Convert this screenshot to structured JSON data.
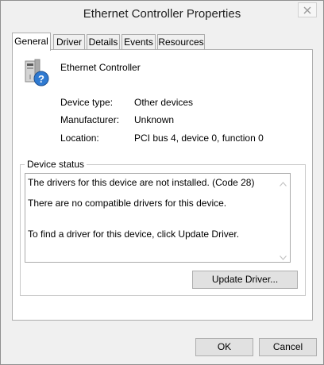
{
  "window": {
    "title": "Ethernet Controller Properties"
  },
  "tabs": [
    {
      "label": "General",
      "active": true
    },
    {
      "label": "Driver",
      "active": false
    },
    {
      "label": "Details",
      "active": false
    },
    {
      "label": "Events",
      "active": false
    },
    {
      "label": "Resources",
      "active": false
    }
  ],
  "device": {
    "name": "Ethernet Controller",
    "icon": "unknown-device-icon"
  },
  "properties": {
    "type_label": "Device type:",
    "type_value": "Other devices",
    "manufacturer_label": "Manufacturer:",
    "manufacturer_value": "Unknown",
    "location_label": "Location:",
    "location_value": "PCI bus 4, device 0, function 0"
  },
  "device_status": {
    "label": "Device status",
    "lines": [
      "The drivers for this device are not installed. (Code 28)",
      "There are no compatible drivers for this device.",
      "To find a driver for this device, click Update Driver."
    ]
  },
  "buttons": {
    "update_driver": "Update Driver...",
    "ok": "OK",
    "cancel": "Cancel"
  },
  "colors": {
    "window_bg": "#f0f0f0",
    "panel_bg": "#ffffff",
    "border": "#adadad"
  }
}
